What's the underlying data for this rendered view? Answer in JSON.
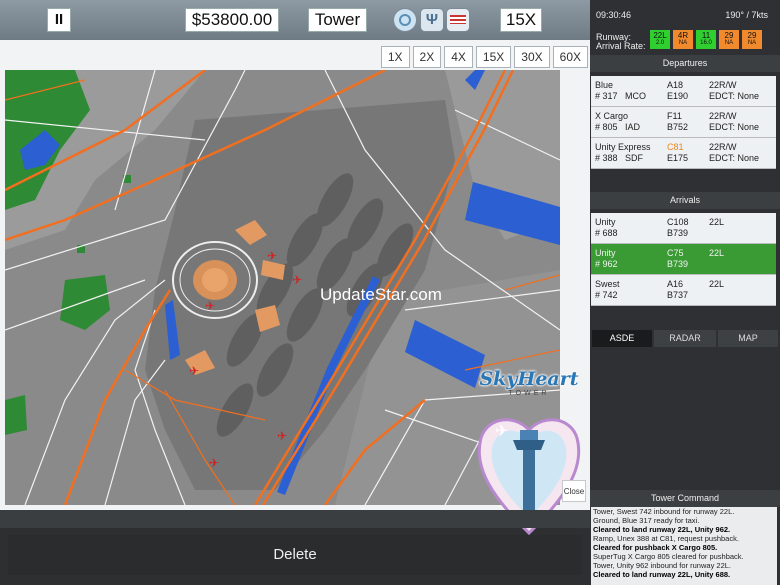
{
  "toolbar": {
    "pause_label": "II",
    "money": "$53800.00",
    "mode": "Tower",
    "speed": "15X"
  },
  "speed_options": [
    "1X",
    "2X",
    "4X",
    "15X",
    "30X",
    "60X"
  ],
  "map": {
    "watermark": "UpdateStar.com",
    "close_label": "Close",
    "logo_title": "SkyHeart",
    "logo_subtitle": "TOWER"
  },
  "bottom": {
    "delete_label": "Delete"
  },
  "status": {
    "clock": "09:30:46",
    "wind": "190° / 7kts",
    "runway_label": "Runway:",
    "arrival_rate_label": "Arrival Rate:",
    "runways": [
      {
        "name": "22L",
        "rate": "2.0",
        "color": "#2fcf2f"
      },
      {
        "name": "4R",
        "rate": "NA",
        "color": "#f08a2d"
      },
      {
        "name": "11",
        "rate": "16.0",
        "color": "#2fcf2f"
      },
      {
        "name": "29",
        "rate": "NA",
        "color": "#f08a2d"
      },
      {
        "name": "29",
        "rate": "NA",
        "color": "#f08a2d"
      }
    ]
  },
  "departures": {
    "title": "Departures",
    "items": [
      {
        "airline": "Blue",
        "flight": "# 317",
        "dest": "MCO",
        "gate": "A18",
        "type": "E190",
        "runway": "22R/W",
        "edct": "EDCT: None"
      },
      {
        "airline": "X Cargo",
        "flight": "# 805",
        "dest": "IAD",
        "gate": "F11",
        "type": "B752",
        "runway": "22R/W",
        "edct": "EDCT: None"
      },
      {
        "airline": "Unity Express",
        "flight": "# 388",
        "dest": "SDF",
        "gate": "C81",
        "type": "E175",
        "runway": "22R/W",
        "edct": "EDCT: None"
      }
    ]
  },
  "arrivals": {
    "title": "Arrivals",
    "items": [
      {
        "airline": "Unity",
        "flight": "# 688",
        "gate": "C108",
        "type": "B739",
        "runway": "22L"
      },
      {
        "airline": "Unity",
        "flight": "# 962",
        "gate": "C75",
        "type": "B739",
        "runway": "22L"
      },
      {
        "airline": "Swest",
        "flight": "# 742",
        "gate": "A16",
        "type": "B737",
        "runway": "22L"
      }
    ]
  },
  "tabs": [
    "ASDE",
    "RADAR",
    "MAP"
  ],
  "tower_command": {
    "title": "Tower Command",
    "lines": [
      "Tower, Swest 742 inbound for runway 22L.",
      "Ground, Blue 317 ready for taxi.",
      "Cleared to land runway 22L, Unity 962.",
      "Ramp, Unex 388 at C81, request pushback.",
      "Cleared for pushback X Cargo 805.",
      "SuperTug X Cargo 805 cleared for pushback.",
      "Tower, Unity 962 inbound for runway 22L.",
      "Cleared to land runway 22L, Unity 688."
    ]
  }
}
